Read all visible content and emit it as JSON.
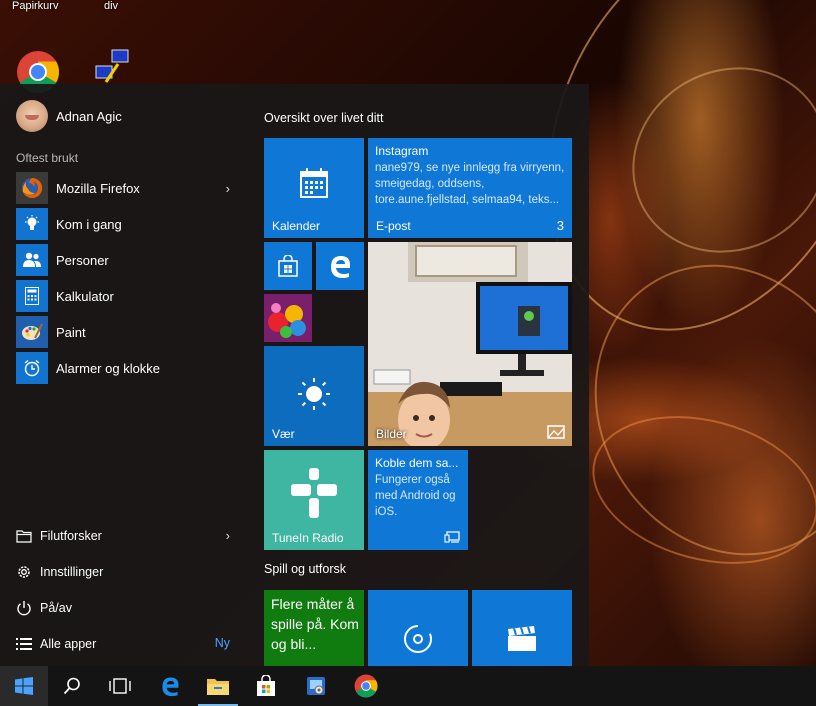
{
  "desktop": {
    "icons": [
      {
        "label": "Papirkurv"
      },
      {
        "label": "div"
      }
    ]
  },
  "start_menu": {
    "user": {
      "name": "Adnan Agic"
    },
    "most_used_label": "Oftest brukt",
    "apps": [
      {
        "label": "Mozilla Firefox",
        "icon": "firefox-icon",
        "has_submenu": true
      },
      {
        "label": "Kom i gang",
        "icon": "lightbulb-icon",
        "has_submenu": false
      },
      {
        "label": "Personer",
        "icon": "people-icon",
        "has_submenu": false
      },
      {
        "label": "Kalkulator",
        "icon": "calculator-icon",
        "has_submenu": false
      },
      {
        "label": "Paint",
        "icon": "paint-icon",
        "has_submenu": false
      },
      {
        "label": "Alarmer og klokke",
        "icon": "alarm-clock-icon",
        "has_submenu": false
      }
    ],
    "bottom": {
      "file_explorer": "Filutforsker",
      "settings": "Innstillinger",
      "power": "På/av",
      "all_apps": "Alle apper",
      "new_badge": "Ny"
    },
    "groups": {
      "overview_title": "Oversikt over livet ditt",
      "play_title": "Spill og utforsk"
    },
    "tiles": {
      "calendar": "Kalender",
      "mail_sender": "Instagram",
      "mail_preview": "nane979, se nye innlegg fra virryenn, smeigedag, oddsens, tore.aune.fjellstad, selmaa94, teks...",
      "mail_label": "E-post",
      "mail_count": "3",
      "weather": "Vær",
      "photos": "Bilder",
      "tunein": "TuneIn Radio",
      "phone_title": "Koble dem sa...",
      "phone_text": "Fungerer også med Android og iOS.",
      "xbox_text": "Flere måter å spille på. Kom og bli..."
    }
  },
  "taskbar": {
    "items": [
      "start",
      "search",
      "task-view",
      "edge",
      "file-explorer",
      "store",
      "control-panel",
      "chrome"
    ]
  },
  "colors": {
    "accent": "#0f78d7",
    "tunein": "#3eb6a2",
    "xbox": "#107c10",
    "start_bg": "#1a1818"
  }
}
